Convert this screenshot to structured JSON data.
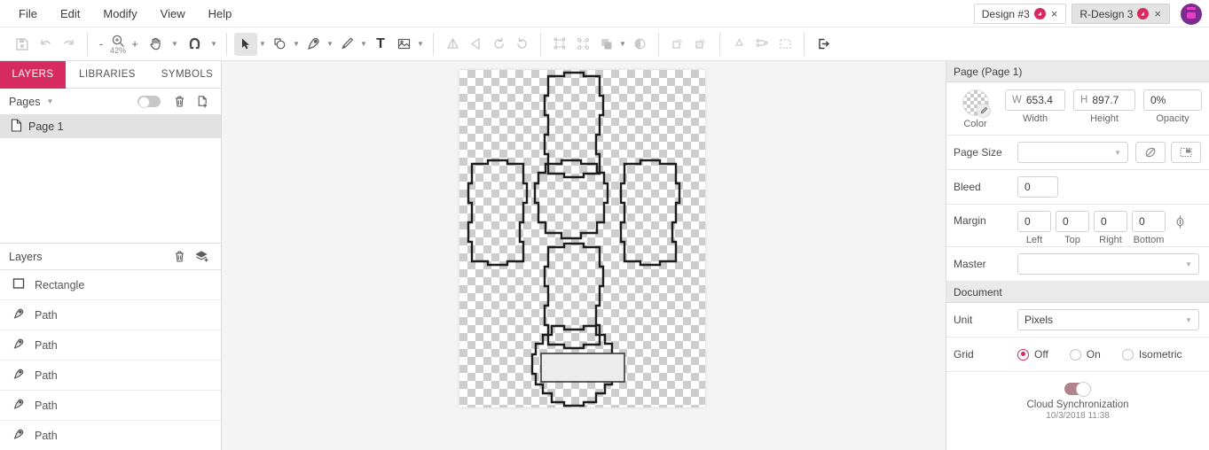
{
  "menu": {
    "items": [
      "File",
      "Edit",
      "Modify",
      "View",
      "Help"
    ]
  },
  "tabs": [
    {
      "label": "Design #3",
      "badge": "◔",
      "close": "×",
      "active": false
    },
    {
      "label": "R-Design 3",
      "badge": "◔",
      "close": "×",
      "active": true
    }
  ],
  "avatar": {
    "name": "user-avatar"
  },
  "toolbar": {
    "save": "save-icon",
    "undo": "undo-icon",
    "redo": "redo-icon",
    "zoom_minus": "-",
    "zoom_plus": "+",
    "zoom_level": "42%",
    "hand": "hand-icon",
    "magnet": "magnet-snap-icon",
    "select": "select-arrow-icon",
    "shape": "shape-icon",
    "pen": "pen-icon",
    "pencil": "pencil-icon",
    "text": "T",
    "image": "image-icon",
    "boolean_union": "boolean-union-icon",
    "flip_h": "flip-horizontal-icon",
    "rotate_ccw": "rotate-ccw-icon",
    "rotate_cw": "rotate-cw-icon",
    "group": "group-icon",
    "ungroup": "ungroup-icon",
    "arrange": "arrange-icon",
    "mask": "mask-icon",
    "bring_forward": "bring-forward-icon",
    "send_backward": "send-backward-icon",
    "recycle": "recycle-icon",
    "connect": "connect-nodes-icon",
    "marquee": "marquee-select-icon",
    "export": "export-icon"
  },
  "left_panel": {
    "tabs": [
      {
        "label": "LAYERS",
        "active": true
      },
      {
        "label": "LIBRARIES",
        "active": false
      },
      {
        "label": "SYMBOLS",
        "active": false
      }
    ],
    "pages": {
      "title": "Pages",
      "toggle": "pages-visibility-toggle",
      "delete_icon": "trash-icon",
      "add_icon": "add-page-icon",
      "items": [
        {
          "label": "Page 1",
          "icon": "page-icon",
          "selected": true
        }
      ]
    },
    "layers": {
      "title": "Layers",
      "delete_icon": "trash-icon",
      "add_icon": "add-layer-icon",
      "items": [
        {
          "label": "Rectangle",
          "icon": "rectangle-icon"
        },
        {
          "label": "Path",
          "icon": "pen-path-icon"
        },
        {
          "label": "Path",
          "icon": "pen-path-icon"
        },
        {
          "label": "Path",
          "icon": "pen-path-icon"
        },
        {
          "label": "Path",
          "icon": "pen-path-icon"
        },
        {
          "label": "Path",
          "icon": "pen-path-icon"
        }
      ]
    }
  },
  "right_panel": {
    "page_section": {
      "header": "Page (Page 1)",
      "color_caption": "Color",
      "width_unit": "W",
      "width_value": "653.4",
      "width_caption": "Width",
      "height_unit": "H",
      "height_value": "897.7",
      "height_caption": "Height",
      "opacity_value": "0%",
      "opacity_caption": "Opacity",
      "page_size_label": "Page Size",
      "page_size_value": "",
      "orientation_icon": "rotate-orientation-icon",
      "fit_icon": "fit-to-content-icon",
      "bleed_label": "Bleed",
      "bleed_value": "0",
      "margin_label": "Margin",
      "margin_left": "0",
      "margin_top": "0",
      "margin_right": "0",
      "margin_bottom": "0",
      "margin_cap_left": "Left",
      "margin_cap_top": "Top",
      "margin_cap_right": "Right",
      "margin_cap_bottom": "Bottom",
      "margin_link_icon": "link-margins-icon",
      "master_label": "Master",
      "master_value": ""
    },
    "document_section": {
      "header": "Document",
      "unit_label": "Unit",
      "unit_value": "Pixels",
      "grid_label": "Grid",
      "grid_options": [
        {
          "label": "Off",
          "selected": true
        },
        {
          "label": "On",
          "selected": false
        },
        {
          "label": "Isometric",
          "selected": false
        }
      ],
      "cloud_toggle": "cloud-sync-toggle",
      "cloud_label": "Cloud Synchronization",
      "cloud_time": "10/3/2018 11:38"
    }
  },
  "colors": {
    "accent": "#d62a60",
    "panel_border": "#dcdcdc",
    "canvas_bg": "#f4f4f4",
    "avatar_bg": "#7b2d8e",
    "avatar_fg": "#e83fc8"
  }
}
